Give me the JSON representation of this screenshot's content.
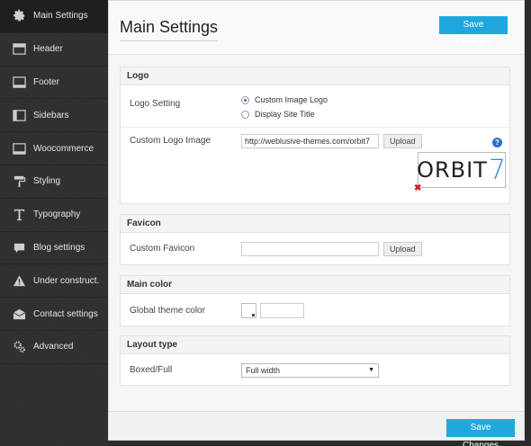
{
  "sidebar": {
    "items": [
      {
        "label": "Main Settings",
        "icon": "gear-icon"
      },
      {
        "label": "Header",
        "icon": "header-layout-icon"
      },
      {
        "label": "Footer",
        "icon": "footer-layout-icon"
      },
      {
        "label": "Sidebars",
        "icon": "sidebar-layout-icon"
      },
      {
        "label": "Woocommerce",
        "icon": "woocommerce-layout-icon"
      },
      {
        "label": "Styling",
        "icon": "paint-roller-icon"
      },
      {
        "label": "Typography",
        "icon": "typography-icon"
      },
      {
        "label": "Blog settings",
        "icon": "speech-bubble-icon"
      },
      {
        "label": "Under construct.",
        "icon": "warning-icon"
      },
      {
        "label": "Contact settings",
        "icon": "envelope-icon"
      },
      {
        "label": "Advanced",
        "icon": "gears-icon"
      }
    ]
  },
  "header": {
    "title": "Main Settings",
    "save_label": "Save Changes"
  },
  "footer": {
    "save_label": "Save Changes"
  },
  "logo": {
    "title": "Logo",
    "setting_label": "Logo Setting",
    "option_custom": "Custom Image Logo",
    "option_site_title": "Display Site Title",
    "custom_image_label": "Custom Logo Image",
    "custom_image_value": "http://weblusive-themes.com/orbit7",
    "upload_label": "Upload",
    "help_glyph": "?",
    "preview_text": "ORBIT",
    "preview_digit": "7",
    "remove_glyph": "✖"
  },
  "favicon": {
    "title": "Favicon",
    "label": "Custom Favicon",
    "value": "",
    "upload_label": "Upload"
  },
  "main_color": {
    "title": "Main color",
    "label": "Global theme color",
    "value": ""
  },
  "layout_type": {
    "title": "Layout type",
    "label": "Boxed/Full",
    "selected": "Full width",
    "caret": "▼"
  },
  "colors": {
    "accent": "#1fa8e0",
    "sidebar_bg": "#2f2f2f",
    "remove": "#d21e1e"
  }
}
